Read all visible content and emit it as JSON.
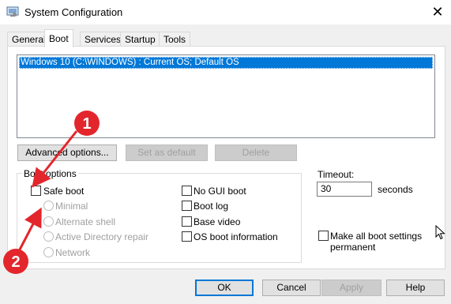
{
  "window": {
    "title": "System Configuration",
    "close_glyph": "✕"
  },
  "tabs": [
    {
      "label": "General"
    },
    {
      "label": "Boot"
    },
    {
      "label": "Services"
    },
    {
      "label": "Startup"
    },
    {
      "label": "Tools"
    }
  ],
  "os_list": {
    "entries": [
      "Windows 10 (C:\\WINDOWS) : Current OS; Default OS"
    ]
  },
  "buttons": {
    "advanced": "Advanced options...",
    "set_default": "Set as default",
    "delete": "Delete",
    "ok": "OK",
    "cancel": "Cancel",
    "apply": "Apply",
    "help": "Help"
  },
  "boot_options": {
    "legend": "Boot options",
    "safe_boot": "Safe boot",
    "minimal": "Minimal",
    "alternate_shell": "Alternate shell",
    "active_directory_repair": "Active Directory repair",
    "network": "Network",
    "no_gui_boot": "No GUI boot",
    "boot_log": "Boot log",
    "base_video": "Base video",
    "os_boot_information": "OS boot information"
  },
  "timeout": {
    "label": "Timeout:",
    "value": "30",
    "unit": "seconds"
  },
  "make_permanent": {
    "line1": "Make all boot settings",
    "line2": "permanent"
  },
  "annotations": {
    "marker_1": "1",
    "marker_2": "2"
  },
  "colors": {
    "selection": "#0078d7",
    "annotation": "#e3262b"
  },
  "icons": {
    "app": "msconfig-icon",
    "cursor": "mouse-pointer-icon"
  }
}
